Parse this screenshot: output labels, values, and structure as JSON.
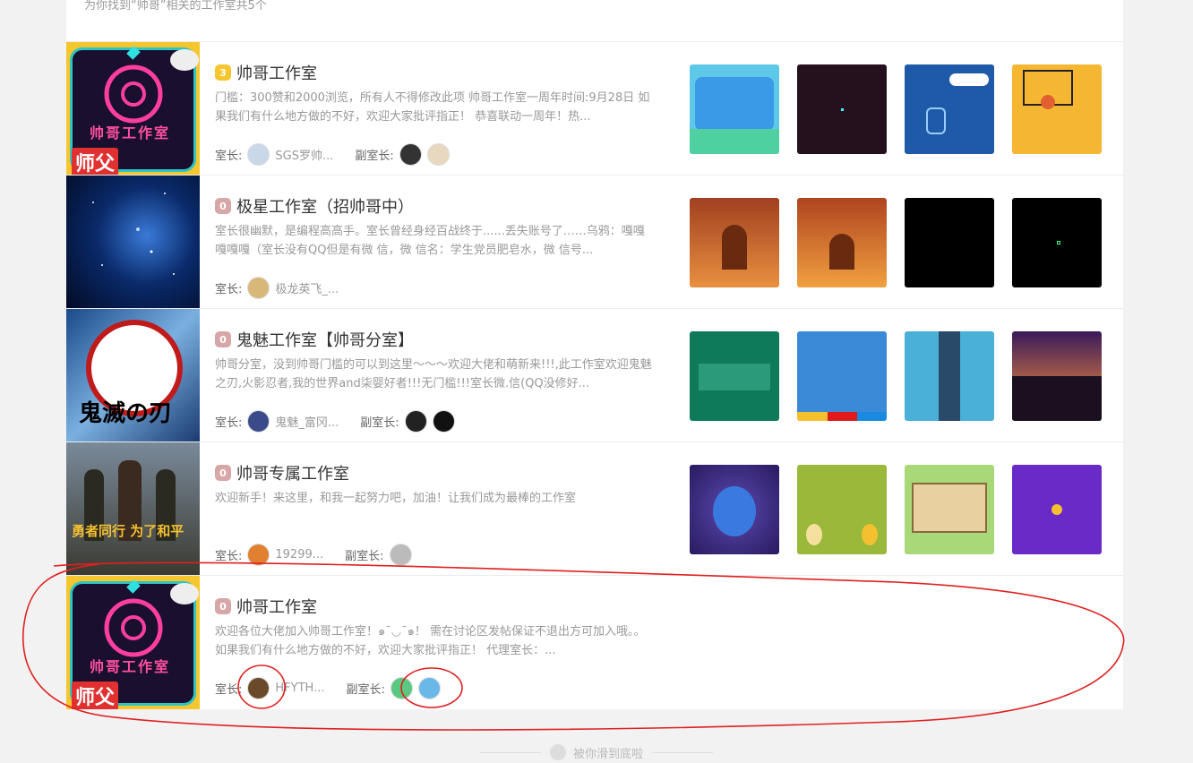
{
  "header": {
    "result_count": "为你找到“帅哥”相关的工作室共5个"
  },
  "studios": [
    {
      "level": "3",
      "title": "帅哥工作室",
      "desc": "门槛：300赞和2000浏览，所有人不得修改此项 帅哥工作室一周年时间:9月28日 如果我们有什么地方做的不好，欢迎大家批评指正！ 恭喜联动一周年！热...",
      "owner_label": "室长:",
      "owner_name": "SGS罗帅...",
      "deputy_label": "副室长:",
      "cover_text": "帅哥工作室",
      "cover_badge": "师父"
    },
    {
      "level": "0",
      "title": "极星工作室（招帅哥中）",
      "desc": "室长很幽默，是编程高高手。室长曾经身经百战终于......丢失账号了……乌鸦：嘎嘎嘎嘎嘎（室长没有QQ但是有微 信，微 信名：学生党员肥皂水，微 信号...",
      "owner_label": "室长:",
      "owner_name": "极龙英飞_...",
      "deputy_label": ""
    },
    {
      "level": "0",
      "title": "鬼魅工作室【帅哥分室】",
      "desc": "帅哥分室，没到帅哥门槛的可以到这里～～～欢迎大佬和萌新来!!!,此工作室欢迎鬼魅之刃,火影忍者,我的世界and柒婴好者!!!无门槛!!!室长微.信(QQ没修好...",
      "owner_label": "室长:",
      "owner_name": "鬼魅_富冈...",
      "deputy_label": "副室长:",
      "cover_text": "鬼滅の刃"
    },
    {
      "level": "0",
      "title": "帅哥专属工作室",
      "desc": "欢迎新手！来这里，和我一起努力吧，加油！让我们成为最棒的工作室",
      "owner_label": "室长:",
      "owner_name": "19299...",
      "deputy_label": "副室长:",
      "cover_text": "勇者同行 为了和平"
    },
    {
      "level": "0",
      "title": "帅哥工作室",
      "desc": "欢迎各位大佬加入帅哥工作室！๑¯◡¯๑！ 需在讨论区发帖保证不退出方可加入哦。。 如果我们有什么地方做的不好，欢迎大家批评指正！ 代理室长：...",
      "owner_label": "室长:",
      "owner_name": "HFYTH...",
      "deputy_label": "副室长:",
      "cover_text": "帅哥工作室",
      "cover_badge": "师父"
    }
  ],
  "footer": {
    "text": "被你滑到底啦"
  },
  "colors": {
    "accent_gold": "#f6c62e",
    "level_pink": "#d7a7a7",
    "annotation_red": "#e02020"
  }
}
